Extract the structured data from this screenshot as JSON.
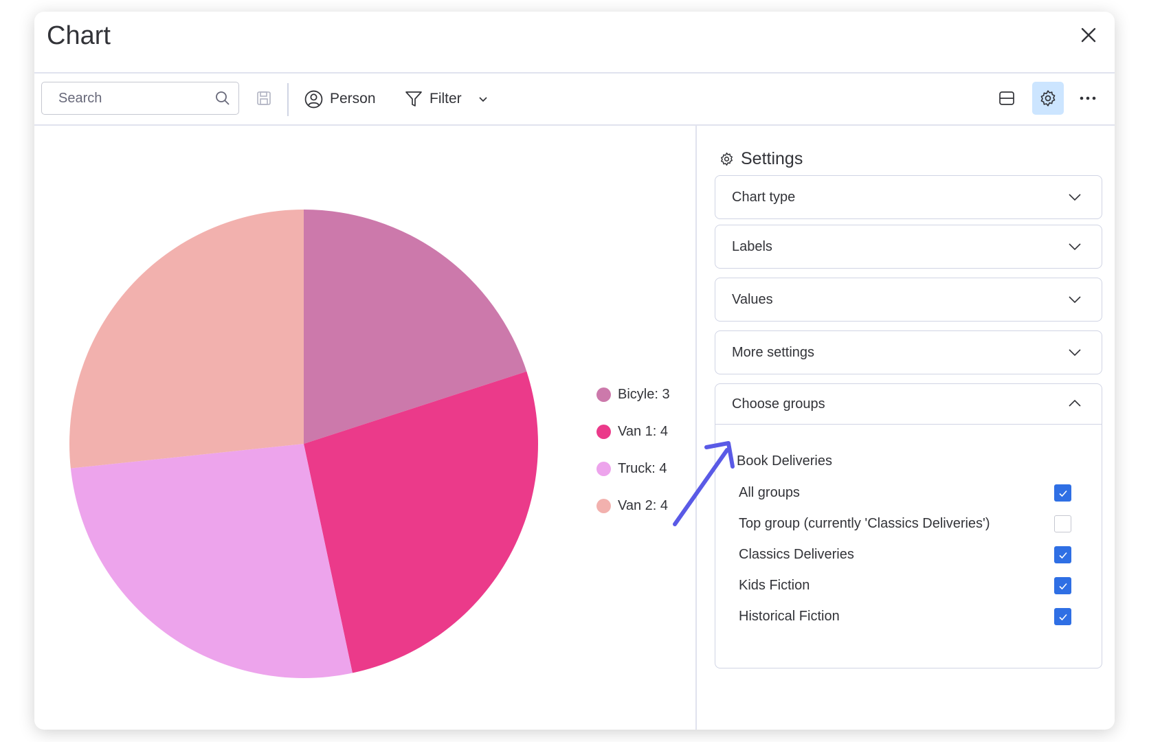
{
  "window": {
    "title": "Chart"
  },
  "toolbar": {
    "search_placeholder": "Search",
    "person_label": "Person",
    "filter_label": "Filter"
  },
  "chart_data": {
    "type": "pie",
    "categories": [
      "Bicyle",
      "Van 1",
      "Truck",
      "Van 2"
    ],
    "values": [
      3,
      4,
      4,
      4
    ],
    "colors": [
      "#cc79ab",
      "#eb3a8a",
      "#eda4ec",
      "#f2b1ae"
    ],
    "legend_labels": [
      "Bicyle: 3",
      "Van 1: 4",
      "Truck: 4",
      "Van 2: 4"
    ],
    "legend_placement": "right"
  },
  "settings": {
    "title": "Settings",
    "sections": [
      {
        "label": "Chart type",
        "expanded": false
      },
      {
        "label": "Labels",
        "expanded": false
      },
      {
        "label": "Values",
        "expanded": false
      },
      {
        "label": "More settings",
        "expanded": false
      },
      {
        "label": "Choose groups",
        "expanded": true
      }
    ],
    "board_name": "Book Deliveries",
    "groups": [
      {
        "label": "All groups",
        "checked": true
      },
      {
        "label": "Top group (currently 'Classics Deliveries')",
        "checked": false
      },
      {
        "label": "Classics Deliveries",
        "checked": true
      },
      {
        "label": "Kids Fiction",
        "checked": true
      },
      {
        "label": "Historical Fiction",
        "checked": true
      }
    ]
  },
  "colors": {
    "accent": "#2f6fe4",
    "active_button_bg": "#cce5ff",
    "annotation_arrow": "#5a5ae6"
  }
}
